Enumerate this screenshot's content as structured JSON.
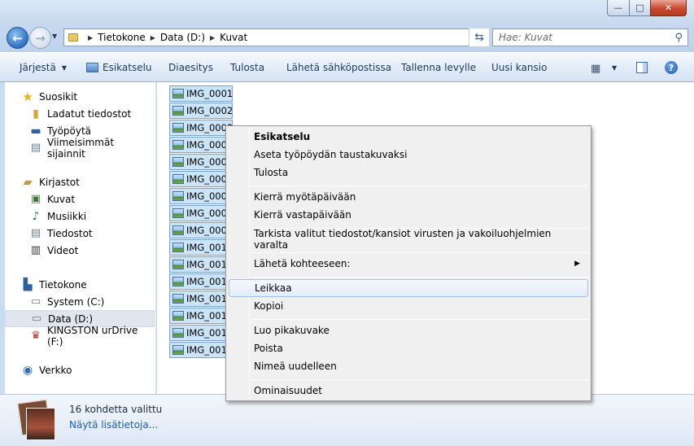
{
  "window": {
    "minimize_glyph": "—",
    "maximize_glyph": "□",
    "close_glyph": "✕"
  },
  "address_bar": {
    "crumbs": [
      "Tietokone",
      "Data (D:)",
      "Kuvat"
    ]
  },
  "search": {
    "placeholder": "Hae: Kuvat"
  },
  "toolbar": {
    "organize": "Järjestä",
    "preview": "Esikatselu",
    "slideshow": "Diaesitys",
    "print": "Tulosta",
    "email": "Lähetä sähköpostissa",
    "burn": "Tallenna levylle",
    "new_folder": "Uusi kansio"
  },
  "nav": {
    "favorites": "Suosikit",
    "downloads": "Ladatut tiedostot",
    "desktop": "Työpöytä",
    "recent": "Viimeisimmät sijainnit",
    "libraries": "Kirjastot",
    "pictures": "Kuvat",
    "music": "Musiikki",
    "documents": "Tiedostot",
    "videos": "Videot",
    "computer": "Tietokone",
    "drive_c": "System (C:)",
    "drive_d": "Data (D:)",
    "drive_f": "KINGSTON urDrive (F:)",
    "network": "Verkko"
  },
  "files": [
    "IMG_0001",
    "IMG_0002",
    "IMG_0003",
    "IMG_0004",
    "IMG_0005",
    "IMG_0006",
    "IMG_0007",
    "IMG_0008",
    "IMG_0009",
    "IMG_0010",
    "IMG_0011",
    "IMG_0012",
    "IMG_0013",
    "IMG_0014",
    "IMG_0015",
    "IMG_0016"
  ],
  "context_menu": {
    "preview": "Esikatselu",
    "set_background": "Aseta työpöydän taustakuvaksi",
    "print": "Tulosta",
    "rotate_cw": "Kierrä myötäpäivään",
    "rotate_ccw": "Kierrä vastapäivään",
    "scan": "Tarkista valitut tiedostot/kansiot virusten ja vakoiluohjelmien varalta",
    "send_to": "Lähetä kohteeseen:",
    "cut": "Leikkaa",
    "copy": "Kopioi",
    "create_shortcut": "Luo pikakuvake",
    "delete": "Poista",
    "rename": "Nimeä uudelleen",
    "properties": "Ominaisuudet"
  },
  "details": {
    "selected_count": "16 kohdetta valittu",
    "more_info": "Näytä lisätietoja..."
  }
}
